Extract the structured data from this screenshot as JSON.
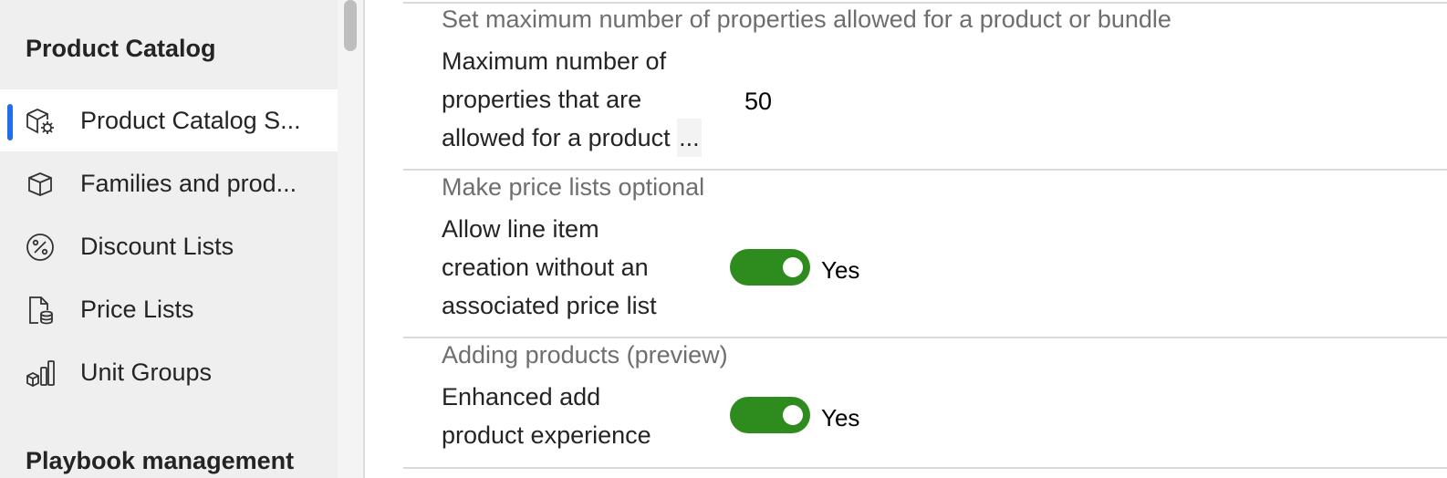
{
  "sidebar": {
    "section_title": "Product Catalog",
    "items": [
      {
        "label": "Product Catalog S...",
        "icon": "box-gear-icon",
        "selected": true
      },
      {
        "label": "Families and prod...",
        "icon": "box-icon",
        "selected": false
      },
      {
        "label": "Discount Lists",
        "icon": "percent-icon",
        "selected": false
      },
      {
        "label": "Price Lists",
        "icon": "document-coins-icon",
        "selected": false
      },
      {
        "label": "Unit Groups",
        "icon": "unit-groups-icon",
        "selected": false
      }
    ],
    "next_section_title": "Playbook management"
  },
  "settings": {
    "max_properties": {
      "section_title": "Set maximum number of properties allowed for a product or bundle",
      "label_line1": "Maximum number of",
      "label_line2": "properties that are",
      "label_line3": "allowed for a product ",
      "label_ellipsis": "...",
      "value": "50"
    },
    "price_lists_optional": {
      "section_title": "Make price lists optional",
      "label_line1": "Allow line item",
      "label_line2": "creation without an",
      "label_line3": "associated price list",
      "toggle_on": true,
      "toggle_text": "Yes"
    },
    "adding_products": {
      "section_title": "Adding products (preview)",
      "label_line1": "Enhanced add",
      "label_line2": "product experience",
      "toggle_on": true,
      "toggle_text": "Yes"
    }
  },
  "colors": {
    "accent": "#1f6feb",
    "toggle_on": "#2e8b1e",
    "sidebar_bg": "#efefef"
  }
}
